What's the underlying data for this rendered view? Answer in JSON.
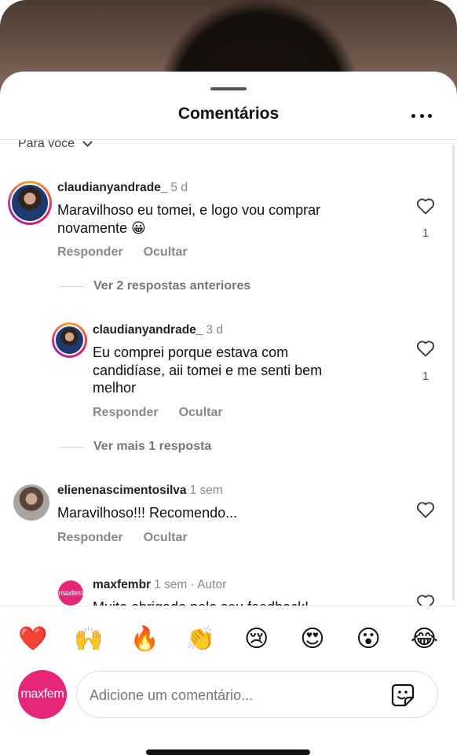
{
  "sheet": {
    "title": "Comentários",
    "sort_label": "Para você"
  },
  "comments": [
    {
      "username": "claudianyandrade_",
      "time": "5 d",
      "text": "Maravilhoso eu tomei, e logo vou comprar\nnovamente 😀",
      "likes": "1",
      "reply_label": "Responder",
      "hide_label": "Ocultar"
    },
    {
      "username": "claudianyandrade_",
      "time": "3 d",
      "text": "Eu comprei porque estava com\ncandidíase, aii tomei e me senti bem\nmelhor",
      "likes": "1",
      "reply_label": "Responder",
      "hide_label": "Ocultar"
    },
    {
      "username": "elienenascimentosilva",
      "time": "1 sem",
      "text": "Maravilhoso!!! Recomendo...",
      "reply_label": "Responder",
      "hide_label": "Ocultar"
    },
    {
      "username": "maxfembr",
      "time": "1 sem · Autor",
      "text": "Muito obrigado pelo seu feedback!",
      "avatar_text": "maxfem"
    }
  ],
  "threads": {
    "previous_replies": "Ver 2 respostas anteriores",
    "more_replies": "Ver mais 1 resposta"
  },
  "reactions": [
    "❤️",
    "🙌",
    "🔥",
    "👏",
    "😢",
    "😍",
    "😮",
    "😂"
  ],
  "composer": {
    "avatar_text": "maxfem",
    "placeholder": "Adicione um comentário...",
    "value": ""
  },
  "colors": {
    "brand": "#e5277a",
    "muted": "#888888"
  }
}
